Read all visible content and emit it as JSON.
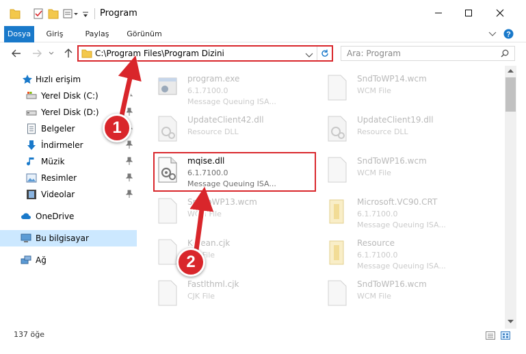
{
  "window": {
    "title": "Program"
  },
  "ribbon": {
    "tabs": [
      "Dosya",
      "Giriş",
      "Paylaş",
      "Görünüm"
    ]
  },
  "address": {
    "path": "C:\\Program Files\\Program Dizini"
  },
  "search": {
    "placeholder": "Ara: Program"
  },
  "nav": {
    "quick_access": "Hızlı erişim",
    "items": [
      {
        "label": "Yerel Disk (C:)",
        "icon": "drive-icon"
      },
      {
        "label": "Yerel Disk (D:)",
        "icon": "drive-icon"
      },
      {
        "label": "Belgeler",
        "icon": "documents-icon"
      },
      {
        "label": "İndirmeler",
        "icon": "download-icon"
      },
      {
        "label": "Müzik",
        "icon": "music-icon"
      },
      {
        "label": "Resimler",
        "icon": "pictures-icon"
      },
      {
        "label": "Videolar",
        "icon": "videos-icon"
      }
    ],
    "onedrive": "OneDrive",
    "this_pc": "Bu bilgisayar",
    "network": "Ağ"
  },
  "files": {
    "left": [
      {
        "name": "program.exe",
        "line2": "6.1.7100.0",
        "line3": "Message Queuing ISA...",
        "icon": "exe-icon"
      },
      {
        "name": "UpdateClient42.dll",
        "line2": "Resource DLL",
        "line3": "",
        "icon": "dll-icon"
      },
      {
        "name": "mqise.dll",
        "line2": "6.1.7100.0",
        "line3": "Message Queuing ISA...",
        "icon": "dll-icon"
      },
      {
        "name": "SndToWP13.wcm",
        "line2": "WCM File",
        "line3": "",
        "icon": "file-icon"
      },
      {
        "name": "Korean.cjk",
        "line2": "CJK File",
        "line3": "",
        "icon": "file-icon"
      },
      {
        "name": "Fastlthml.cjk",
        "line2": "CJK File",
        "line3": "",
        "icon": "file-icon"
      }
    ],
    "right": [
      {
        "name": "SndToWP14.wcm",
        "line2": "WCM File",
        "line3": "",
        "icon": "file-icon"
      },
      {
        "name": "UpdateClient19.dll",
        "line2": "Resource DLL",
        "line3": "",
        "icon": "dll-icon"
      },
      {
        "name": "SndToWP16.wcm",
        "line2": "WCM File",
        "line3": "",
        "icon": "file-icon"
      },
      {
        "name": "Microsoft.VC90.CRT",
        "line2": "6.1.7100.0",
        "line3": "Message Queuing ISA...",
        "icon": "folder-icon"
      },
      {
        "name": "Resource",
        "line2": "6.1.7100.0",
        "line3": "Message Queuing ISA...",
        "icon": "folder-icon"
      },
      {
        "name": "SndToWP16.wcm",
        "line2": "WCM File",
        "line3": "",
        "icon": "file-icon"
      }
    ]
  },
  "status": {
    "count": "137 öğe"
  },
  "annotations": {
    "step1": "1",
    "step2": "2"
  },
  "colors": {
    "accent": "#1979ca",
    "highlight": "#d9262b",
    "selection": "#cce8ff"
  }
}
